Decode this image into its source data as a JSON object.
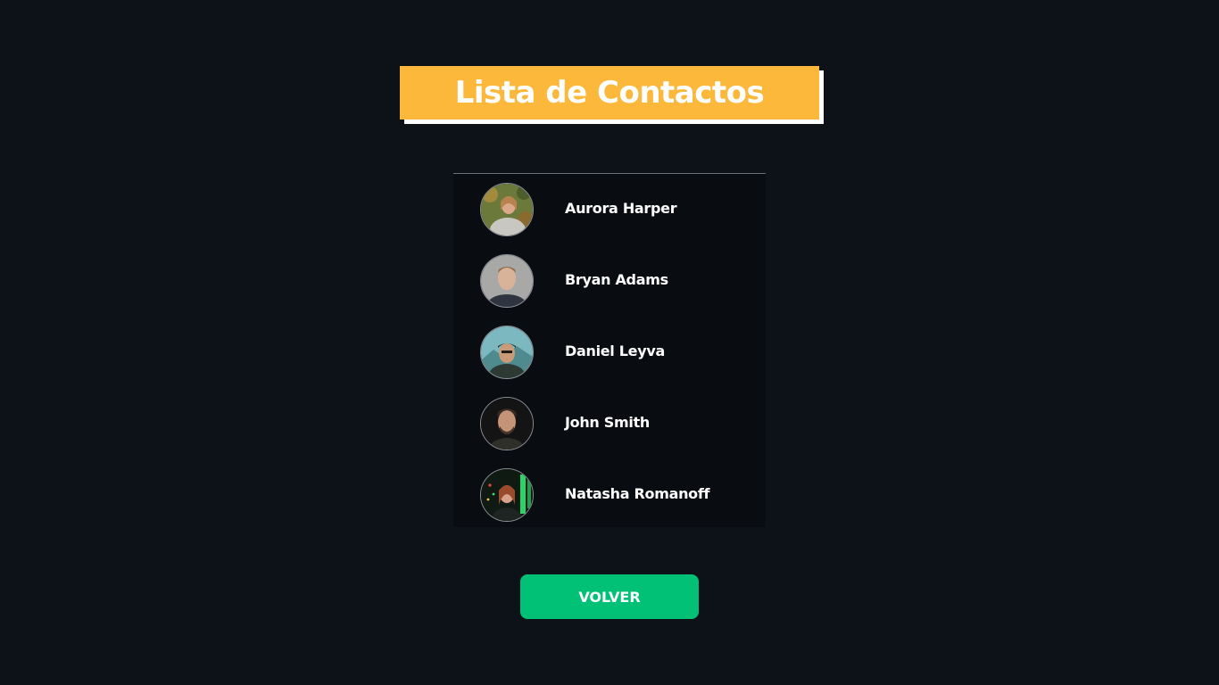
{
  "header": {
    "title": "Lista de Contactos"
  },
  "contacts": [
    {
      "name": "Aurora Harper",
      "avatar": "photo-woman-outdoors"
    },
    {
      "name": "Bryan Adams",
      "avatar": "photo-man-grey-background"
    },
    {
      "name": "Daniel Leyva",
      "avatar": "photo-man-cap-mountains"
    },
    {
      "name": "John Smith",
      "avatar": "photo-man-dark-background"
    },
    {
      "name": "Natasha Romanoff",
      "avatar": "photo-woman-green-lights"
    }
  ],
  "actions": {
    "back_label": "VOLVER"
  },
  "colors": {
    "background": "#0d1118",
    "title_bg": "#fbb83a",
    "title_shadow": "#ffffff",
    "list_bg": "#090c10",
    "button_bg": "#00c176",
    "text": "#ffffff"
  }
}
